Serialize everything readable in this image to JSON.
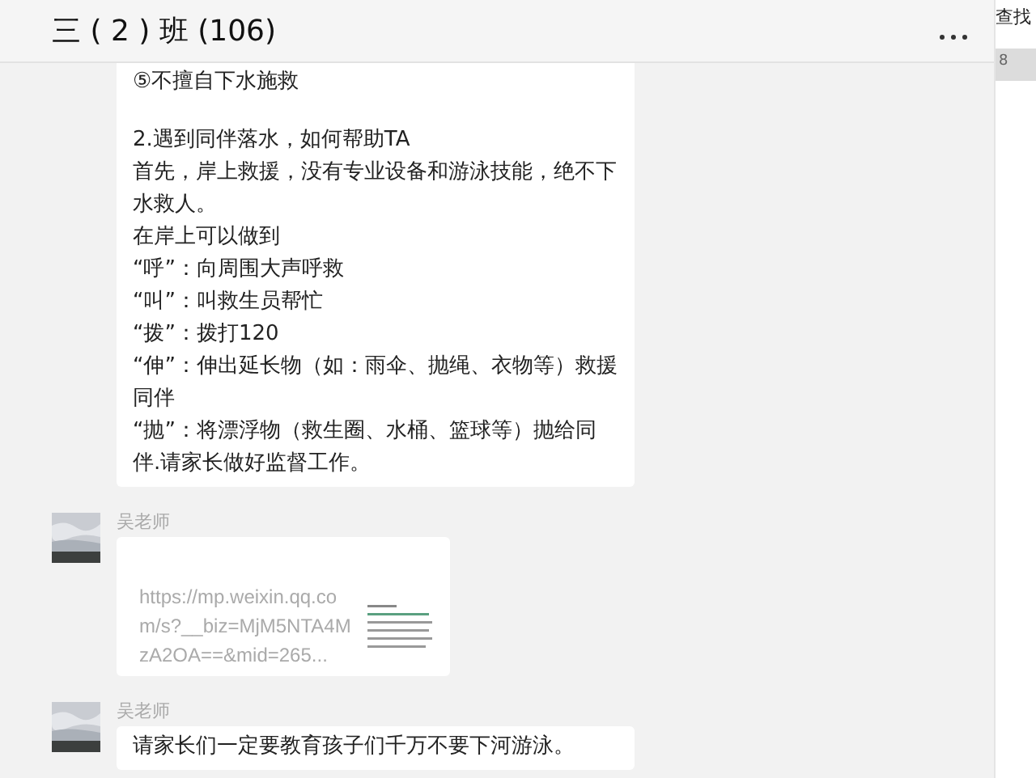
{
  "header": {
    "title": "三 ( 2 ) 班 (106)"
  },
  "messages": [
    {
      "kind": "text",
      "paragraphs": [
        [
          "⑤不擅自下水施救"
        ],
        [
          "2.遇到同伴落水，如何帮助TA",
          "首先，岸上救援，没有专业设备和游泳技能，绝不下水救人。",
          "在岸上可以做到",
          "“呼”：向周围大声呼救",
          "“叫”：叫救生员帮忙",
          "“拨”：拨打120",
          "“伸”：伸出延长物（如：雨伞、抛绳、衣物等）救援同伴",
          "“抛”：将漂浮物（救生圈、水桶、篮球等）抛给同伴.请家长做好监督工作。"
        ]
      ]
    },
    {
      "kind": "link",
      "sender": "吴老师",
      "url": "https://mp.weixin.qq.com/s?__biz=MjM5NTA4MzA2OA==&mid=265..."
    },
    {
      "kind": "text",
      "sender": "吴老师",
      "paragraphs": [
        [
          "请家长们一定要教育孩子们千万不要下河游泳。"
        ]
      ]
    }
  ],
  "side_panel": {
    "search": "查找",
    "item": "8"
  }
}
